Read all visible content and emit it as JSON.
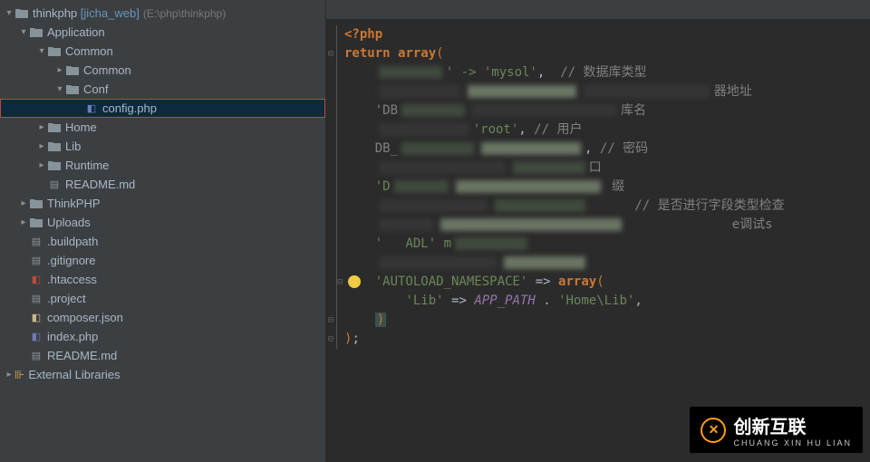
{
  "tree": {
    "root_name": "thinkphp",
    "root_bracket": "[jicha_web]",
    "root_path": "(E:\\php\\thinkphp)",
    "application": "Application",
    "common_dir": "Common",
    "common_sub": "Common",
    "conf": "Conf",
    "config_php": "config.php",
    "home": "Home",
    "lib_dir": "Lib",
    "runtime": "Runtime",
    "readme1": "README.md",
    "thinkphp_dir": "ThinkPHP",
    "uploads": "Uploads",
    "buildpath": ".buildpath",
    "gitignore": ".gitignore",
    "htaccess": ".htaccess",
    "project": ".project",
    "composer": "composer.json",
    "index_php": "index.php",
    "readme2": "README.md",
    "ext_libs": "External Libraries"
  },
  "code": {
    "php_open": "<?php",
    "return_kw": "return",
    "array_kw": "array",
    "paren_open": "(",
    "paren_close": ")",
    "semicolon": ";",
    "arrow": "=>",
    "str_mysol": "'mysol'",
    "cmt_dbtype": "// 数据库类型",
    "cmt_server_addr_partial": "器地址",
    "cmt_dbname_partial": "库名",
    "str_root": "'root'",
    "cmt_user_partial": "// 用户",
    "cmt_password": "// 密码",
    "cmt_port": "口",
    "cmt_prefix_partial": "缀",
    "cmt_fieldcheck": "// 是否进行字段类型检查",
    "cmt_debug_partial": "e调试s",
    "str_adl": "ADL' m",
    "autoload_key": "'AUTOLOAD_NAMESPACE'",
    "lib_key": "'Lib'",
    "app_path_const": "APP_PATH",
    "dot": ".",
    "home_lib_str": "'Home\\Lib'",
    "comma": ","
  },
  "watermark": {
    "brand": "创新互联",
    "sub": "CHUANG XIN HU LIAN"
  }
}
